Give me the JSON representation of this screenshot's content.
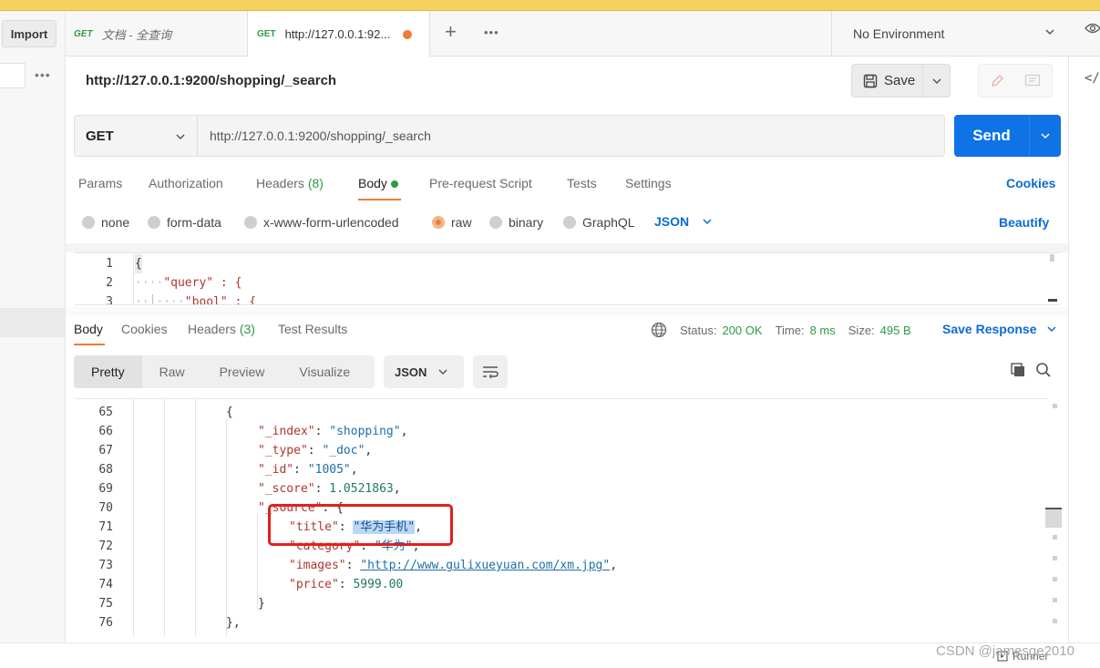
{
  "tabs": [
    {
      "method": "GET",
      "label": "文档 - 全查询"
    },
    {
      "method": "GET",
      "label": "http://127.0.0.1:92..."
    }
  ],
  "toolbar": {
    "import_label": "Import",
    "environment": "No Environment"
  },
  "request": {
    "title": "http://127.0.0.1:9200/shopping/_search",
    "method": "GET",
    "url": "http://127.0.0.1:9200/shopping/_search",
    "save_label": "Save",
    "send_label": "Send"
  },
  "request_tabs": {
    "params": "Params",
    "authorization": "Authorization",
    "headers": "Headers",
    "headers_count": "(8)",
    "body": "Body",
    "prerequest": "Pre-request Script",
    "tests": "Tests",
    "settings": "Settings",
    "cookies": "Cookies"
  },
  "body_types": {
    "none": "none",
    "form_data": "form-data",
    "urlencoded": "x-www-form-urlencoded",
    "raw": "raw",
    "binary": "binary",
    "graphql": "GraphQL",
    "format": "JSON",
    "beautify": "Beautify"
  },
  "editor": {
    "lines": [
      {
        "n": "1",
        "text": "{"
      },
      {
        "n": "2",
        "text": "\"query\" : {"
      },
      {
        "n": "3",
        "text": "\"bool\" : {"
      }
    ]
  },
  "response_tabs": {
    "body": "Body",
    "cookies": "Cookies",
    "headers": "Headers",
    "headers_count": "(3)",
    "test_results": "Test Results"
  },
  "response_status": {
    "status_label": "Status:",
    "status_value": "200 OK",
    "time_label": "Time:",
    "time_value": "8 ms",
    "size_label": "Size:",
    "size_value": "495 B",
    "save_response": "Save Response"
  },
  "view_modes": {
    "pretty": "Pretty",
    "raw": "Raw",
    "preview": "Preview",
    "visualize": "Visualize",
    "format": "JSON"
  },
  "response_lines": {
    "l65": {
      "n": "65",
      "text": "{"
    },
    "l66": {
      "n": "66",
      "key": "\"_index\"",
      "sep": ": ",
      "val": "\"shopping\"",
      "end": ","
    },
    "l67": {
      "n": "67",
      "key": "\"_type\"",
      "sep": ": ",
      "val": "\"_doc\"",
      "end": ","
    },
    "l68": {
      "n": "68",
      "key": "\"_id\"",
      "sep": ": ",
      "val": "\"1005\"",
      "end": ","
    },
    "l69": {
      "n": "69",
      "key": "\"_score\"",
      "sep": ": ",
      "val": "1.0521863",
      "end": ","
    },
    "l70": {
      "n": "70",
      "key": "\"_source\"",
      "sep": ": ",
      "val": "{",
      "end": ""
    },
    "l71": {
      "n": "71",
      "key": "\"title\"",
      "sep": ": ",
      "val": "\"华为手机\"",
      "end": ","
    },
    "l72": {
      "n": "72",
      "key": "\"category\"",
      "sep": ": ",
      "val": "\"华为\"",
      "end": ","
    },
    "l73": {
      "n": "73",
      "key": "\"images\"",
      "sep": ": ",
      "val": "\"http://www.gulixueyuan.com/xm.jpg\"",
      "end": ","
    },
    "l74": {
      "n": "74",
      "key": "\"price\"",
      "sep": ": ",
      "val": "5999.00",
      "end": ""
    },
    "l75": {
      "n": "75",
      "text": "}"
    },
    "l76": {
      "n": "76",
      "text": "},"
    }
  },
  "footer": {
    "runner": "Runner",
    "watermark": "CSDN @jamesge2010"
  },
  "colors": {
    "accent": "#ef7d32",
    "send": "#0f72e5",
    "link": "#0b6bd6",
    "success": "#2e9a46",
    "annotation": "#e0201c"
  }
}
